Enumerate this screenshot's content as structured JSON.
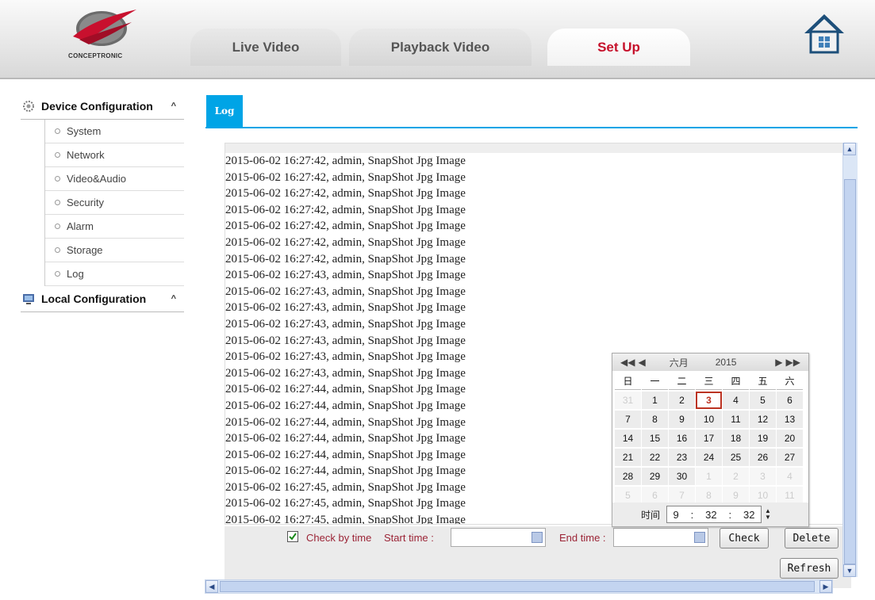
{
  "brand": "CONCEPTRONIC",
  "nav_tabs": [
    {
      "label": "Live Video"
    },
    {
      "label": "Playback Video"
    },
    {
      "label": "Set Up"
    }
  ],
  "sidebar": {
    "device_configuration": {
      "label": "Device Configuration",
      "items": [
        "System",
        "Network",
        "Video&Audio",
        "Security",
        "Alarm",
        "Storage",
        "Log"
      ]
    },
    "local_configuration": {
      "label": "Local Configuration"
    }
  },
  "main_tab": "Log",
  "log_lines": [
    "2015-06-02 16:27:42, admin, SnapShot Jpg Image",
    "2015-06-02 16:27:42, admin, SnapShot Jpg Image",
    "2015-06-02 16:27:42, admin, SnapShot Jpg Image",
    "2015-06-02 16:27:42, admin, SnapShot Jpg Image",
    "2015-06-02 16:27:42, admin, SnapShot Jpg Image",
    "2015-06-02 16:27:42, admin, SnapShot Jpg Image",
    "2015-06-02 16:27:42, admin, SnapShot Jpg Image",
    "2015-06-02 16:27:43, admin, SnapShot Jpg Image",
    "2015-06-02 16:27:43, admin, SnapShot Jpg Image",
    "2015-06-02 16:27:43, admin, SnapShot Jpg Image",
    "2015-06-02 16:27:43, admin, SnapShot Jpg Image",
    "2015-06-02 16:27:43, admin, SnapShot Jpg Image",
    "2015-06-02 16:27:43, admin, SnapShot Jpg Image",
    "2015-06-02 16:27:43, admin, SnapShot Jpg Image",
    "2015-06-02 16:27:44, admin, SnapShot Jpg Image",
    "2015-06-02 16:27:44, admin, SnapShot Jpg Image",
    "2015-06-02 16:27:44, admin, SnapShot Jpg Image",
    "2015-06-02 16:27:44, admin, SnapShot Jpg Image",
    "2015-06-02 16:27:44, admin, SnapShot Jpg Image",
    "2015-06-02 16:27:44, admin, SnapShot Jpg Image",
    "2015-06-02 16:27:45, admin, SnapShot Jpg Image",
    "2015-06-02 16:27:45, admin, SnapShot Jpg Image",
    "2015-06-02 16:27:45, admin, SnapShot Jpg Image"
  ],
  "controls": {
    "check_by_time": "Check by time",
    "check_by_time_checked": true,
    "start_time_label": "Start time :",
    "start_time_value": "",
    "end_time_label": "End time :",
    "end_time_value": "",
    "check_button": "Check",
    "delete_button": "Delete",
    "refresh_button": "Refresh"
  },
  "calendar": {
    "month": "六月",
    "year": "2015",
    "weekdays": [
      "日",
      "一",
      "二",
      "三",
      "四",
      "五",
      "六"
    ],
    "days": [
      {
        "d": "31",
        "dim": true
      },
      {
        "d": "1"
      },
      {
        "d": "2"
      },
      {
        "d": "3",
        "today": true
      },
      {
        "d": "4"
      },
      {
        "d": "5"
      },
      {
        "d": "6"
      },
      {
        "d": "7"
      },
      {
        "d": "8"
      },
      {
        "d": "9"
      },
      {
        "d": "10"
      },
      {
        "d": "11"
      },
      {
        "d": "12"
      },
      {
        "d": "13"
      },
      {
        "d": "14"
      },
      {
        "d": "15"
      },
      {
        "d": "16"
      },
      {
        "d": "17"
      },
      {
        "d": "18"
      },
      {
        "d": "19"
      },
      {
        "d": "20"
      },
      {
        "d": "21"
      },
      {
        "d": "22"
      },
      {
        "d": "23"
      },
      {
        "d": "24"
      },
      {
        "d": "25"
      },
      {
        "d": "26"
      },
      {
        "d": "27"
      },
      {
        "d": "28"
      },
      {
        "d": "29"
      },
      {
        "d": "30"
      },
      {
        "d": "1",
        "dim": true
      },
      {
        "d": "2",
        "dim": true
      },
      {
        "d": "3",
        "dim": true
      },
      {
        "d": "4",
        "dim": true
      },
      {
        "d": "5",
        "dim": true
      },
      {
        "d": "6",
        "dim": true
      },
      {
        "d": "7",
        "dim": true
      },
      {
        "d": "8",
        "dim": true
      },
      {
        "d": "9",
        "dim": true
      },
      {
        "d": "10",
        "dim": true
      },
      {
        "d": "11",
        "dim": true
      }
    ],
    "time_label": "时间",
    "hour": "9",
    "minute": "32",
    "second": "32"
  },
  "colors": {
    "accent": "#00a4e6",
    "active_tab_text": "#c6112b",
    "label_red": "#9b2335"
  }
}
